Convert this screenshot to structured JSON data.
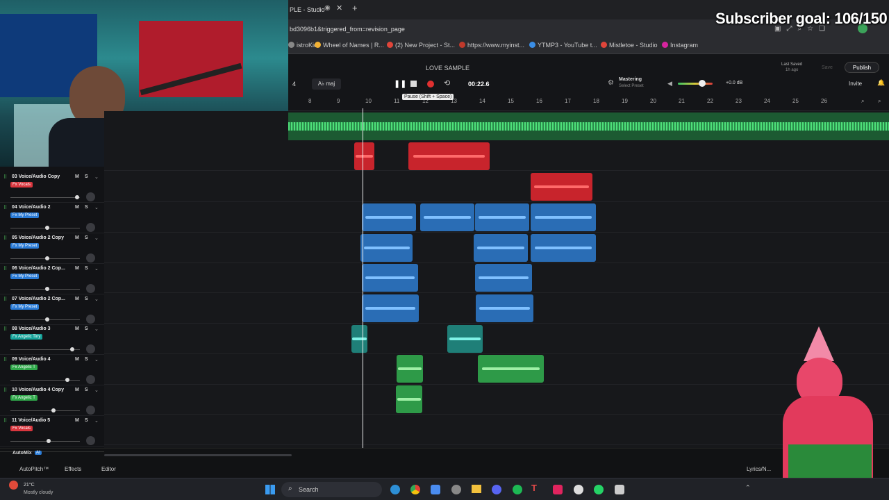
{
  "browser": {
    "tab_title": "PLE - Studio",
    "url": "bd3096b1&triggered_from=revision_page",
    "bookmarks": [
      {
        "label": "istroKid",
        "color": "#888888"
      },
      {
        "label": "Wheel of Names | R...",
        "color": "#f2b134"
      },
      {
        "label": "(2) New Project - St...",
        "color": "#e0453a"
      },
      {
        "label": "https://www.myinst...",
        "color": "#c0392b"
      },
      {
        "label": "YTMP3 - YouTube t...",
        "color": "#3a8ee6"
      },
      {
        "label": "Mistletoe - Studio",
        "color": "#e0453a"
      },
      {
        "label": "Instagram",
        "color": "#d6249f"
      }
    ]
  },
  "overlay": {
    "subscriber_goal": "Subscriber goal: 106/150"
  },
  "studio": {
    "project_title": "LOVE SAMPLE",
    "last_saved_label": "Last Saved",
    "last_saved_value": "1h ago",
    "save_label": "Save",
    "publish_label": "Publish",
    "invite_label": "Invite",
    "bar_number": "4",
    "key_label": "A♭ maj",
    "time": "00:22.6",
    "tooltip": "Pause (Shift + Space)",
    "mastering_label": "Mastering",
    "mastering_preset": "Select Preset",
    "volume_db": "+0.0 dB",
    "accent": "#ffffff"
  },
  "ruler": [
    "8",
    "9",
    "10",
    "11",
    "12",
    "13",
    "14",
    "15",
    "16",
    "17",
    "18",
    "19",
    "20",
    "21",
    "22",
    "23",
    "24",
    "25",
    "26"
  ],
  "tracks": [
    {
      "num": "03",
      "name": "Voice/Audio Copy",
      "fx": "Fx Vocals",
      "fx_color": "#d9363e",
      "vol": 0.96
    },
    {
      "num": "04",
      "name": "Voice/Audio 2",
      "fx": "Fx My Preset",
      "fx_color": "#2a7bd6",
      "vol": 0.53
    },
    {
      "num": "05",
      "name": "Voice/Audio 2 Copy",
      "fx": "Fx My Preset",
      "fx_color": "#2a7bd6",
      "vol": 0.53
    },
    {
      "num": "06",
      "name": "Voice/Audio 2 Cop...",
      "fx": "Fx My Preset",
      "fx_color": "#2a7bd6",
      "vol": 0.53
    },
    {
      "num": "07",
      "name": "Voice/Audio 2 Cop...",
      "fx": "Fx My Preset",
      "fx_color": "#2a7bd6",
      "vol": 0.53
    },
    {
      "num": "08",
      "name": "Voice/Audio 3",
      "fx": "Fx Angelic Tiny",
      "fx_color": "#16a39a",
      "vol": 0.89
    },
    {
      "num": "09",
      "name": "Voice/Audio 4",
      "fx": "Fx Angelic T",
      "fx_color": "#2fa84a",
      "vol": 0.82
    },
    {
      "num": "10",
      "name": "Voice/Audio 4 Copy",
      "fx": "Fx Angelic T",
      "fx_color": "#2fa84a",
      "vol": 0.62
    },
    {
      "num": "11",
      "name": "Voice/Audio 5",
      "fx": "Fx Vocals",
      "fx_color": "#d9363e",
      "vol": 0.55
    }
  ],
  "track_buttons": {
    "mute": "M",
    "solo": "S"
  },
  "bottom": {
    "automix": "AutoMix",
    "automix_badge": "AI",
    "autopitch": "AutoPitch™",
    "effects": "Effects",
    "editor": "Editor",
    "lyrics": "Lyrics/N..."
  },
  "taskbar": {
    "weather_temp": "21°C",
    "weather_desc": "Mostly cloudy",
    "search_label": "Search"
  }
}
